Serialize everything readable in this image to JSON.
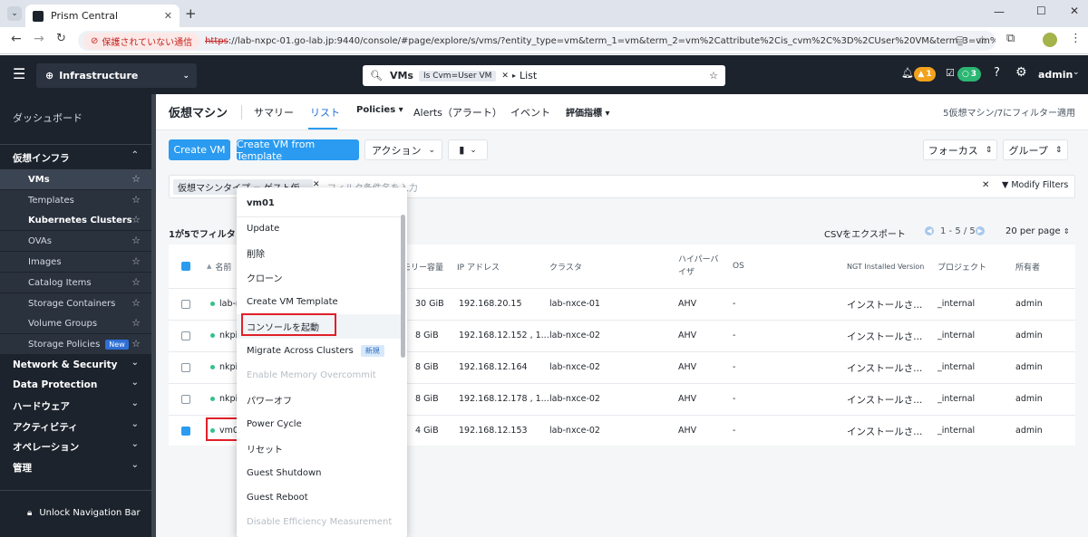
{
  "browser": {
    "tab_title": "Prism Central",
    "security_label": "保護されていない通信",
    "url_scheme": "https",
    "url_rest": "://lab-nxpc-01.go-lab.jp:9440/console/#page/explore/s/vms/?entity_type=vm&term_1=vm&term_2=vm%2Cattribute%2Cis_cvm%2C%3D%2CUser%20VM&term_3=vm%2Cperspective%..."
  },
  "header": {
    "menu_icon": "☰",
    "context": "Infrastructure",
    "search_scope": "VMs",
    "search_chip": "Is Cvm=User VM",
    "search_view": "List",
    "alerts_count": "1",
    "tasks_count": "3",
    "user": "admin"
  },
  "sidebar": {
    "dashboard": "ダッシュボード",
    "section_virtual": "仮想インフラ",
    "items": [
      "VMs",
      "Templates",
      "Kubernetes Clusters",
      "OVAs",
      "Images",
      "Catalog Items",
      "Storage Containers",
      "Volume Groups",
      "Storage Policies"
    ],
    "new_badge": "New",
    "groups": [
      "Network & Security",
      "Data Protection",
      "ハードウェア",
      "アクティビティ",
      "オペレーション",
      "管理"
    ],
    "unlock": "Unlock Navigation Bar"
  },
  "page": {
    "title": "仮想マシン",
    "tabs": [
      "サマリー",
      "リスト",
      "Policies",
      "Alerts（アラート）",
      "イベント",
      "評価指標"
    ],
    "filter_summary": "5仮想マシン/7にフィルター適用"
  },
  "toolbar": {
    "create_vm": "Create VM",
    "create_from_template": "Create VM from Template",
    "actions": "アクション",
    "focus": "フォーカス",
    "group": "グループ"
  },
  "filter": {
    "chip": "仮想マシンタイプ = ゲスト仮...",
    "placeholder": "フィルタ条件名を入力",
    "modify": "Modify Filters"
  },
  "list": {
    "selected_prefix": "1が5でフィルタリ",
    "csv_export": "CSVをエクスポート",
    "pagination": "1 - 5 / 5",
    "per_page": "20 per page"
  },
  "table": {
    "headers": [
      "名前",
      "モリー容量",
      "IP アドレス",
      "クラスタ",
      "ハイパーバイザ",
      "OS",
      "NGT Installed Version",
      "プロジェクト",
      "所有者"
    ],
    "rows": [
      {
        "name": "lab-n",
        "memory": "30 GiB",
        "ip": "192.168.20.15",
        "cluster": "lab-nxce-01",
        "hyp": "AHV",
        "os": "-",
        "ngt": "インストールさ...",
        "project": "_internal",
        "owner": "admin"
      },
      {
        "name": "nkpi",
        "memory": "8 GiB",
        "ip": "192.168.12.152 , 1...",
        "cluster": "lab-nxce-02",
        "hyp": "AHV",
        "os": "-",
        "ngt": "インストールさ...",
        "project": "_internal",
        "owner": "admin"
      },
      {
        "name": "nkpi",
        "memory": "8 GiB",
        "ip": "192.168.12.164",
        "cluster": "lab-nxce-02",
        "hyp": "AHV",
        "os": "-",
        "ngt": "インストールさ...",
        "project": "_internal",
        "owner": "admin"
      },
      {
        "name": "nkpi",
        "memory": "8 GiB",
        "ip": "192.168.12.178 , 1...",
        "cluster": "lab-nxce-02",
        "hyp": "AHV",
        "os": "-",
        "ngt": "インストールさ...",
        "project": "_internal",
        "owner": "admin"
      },
      {
        "name": "vm0",
        "memory": "4 GiB",
        "ip": "192.168.12.153",
        "cluster": "lab-nxce-02",
        "hyp": "AHV",
        "os": "-",
        "ngt": "インストールさ...",
        "project": "_internal",
        "owner": "admin"
      }
    ]
  },
  "menu": {
    "title": "vm01",
    "items": [
      "Update",
      "削除",
      "クローン",
      "Create VM Template",
      "コンソールを起動",
      "Migrate Across Clusters",
      "Enable Memory Overcommit",
      "パワーオフ",
      "Power Cycle",
      "リセット",
      "Guest Shutdown",
      "Guest Reboot",
      "Disable Efficiency Measurement"
    ],
    "new_badge": "新規"
  }
}
